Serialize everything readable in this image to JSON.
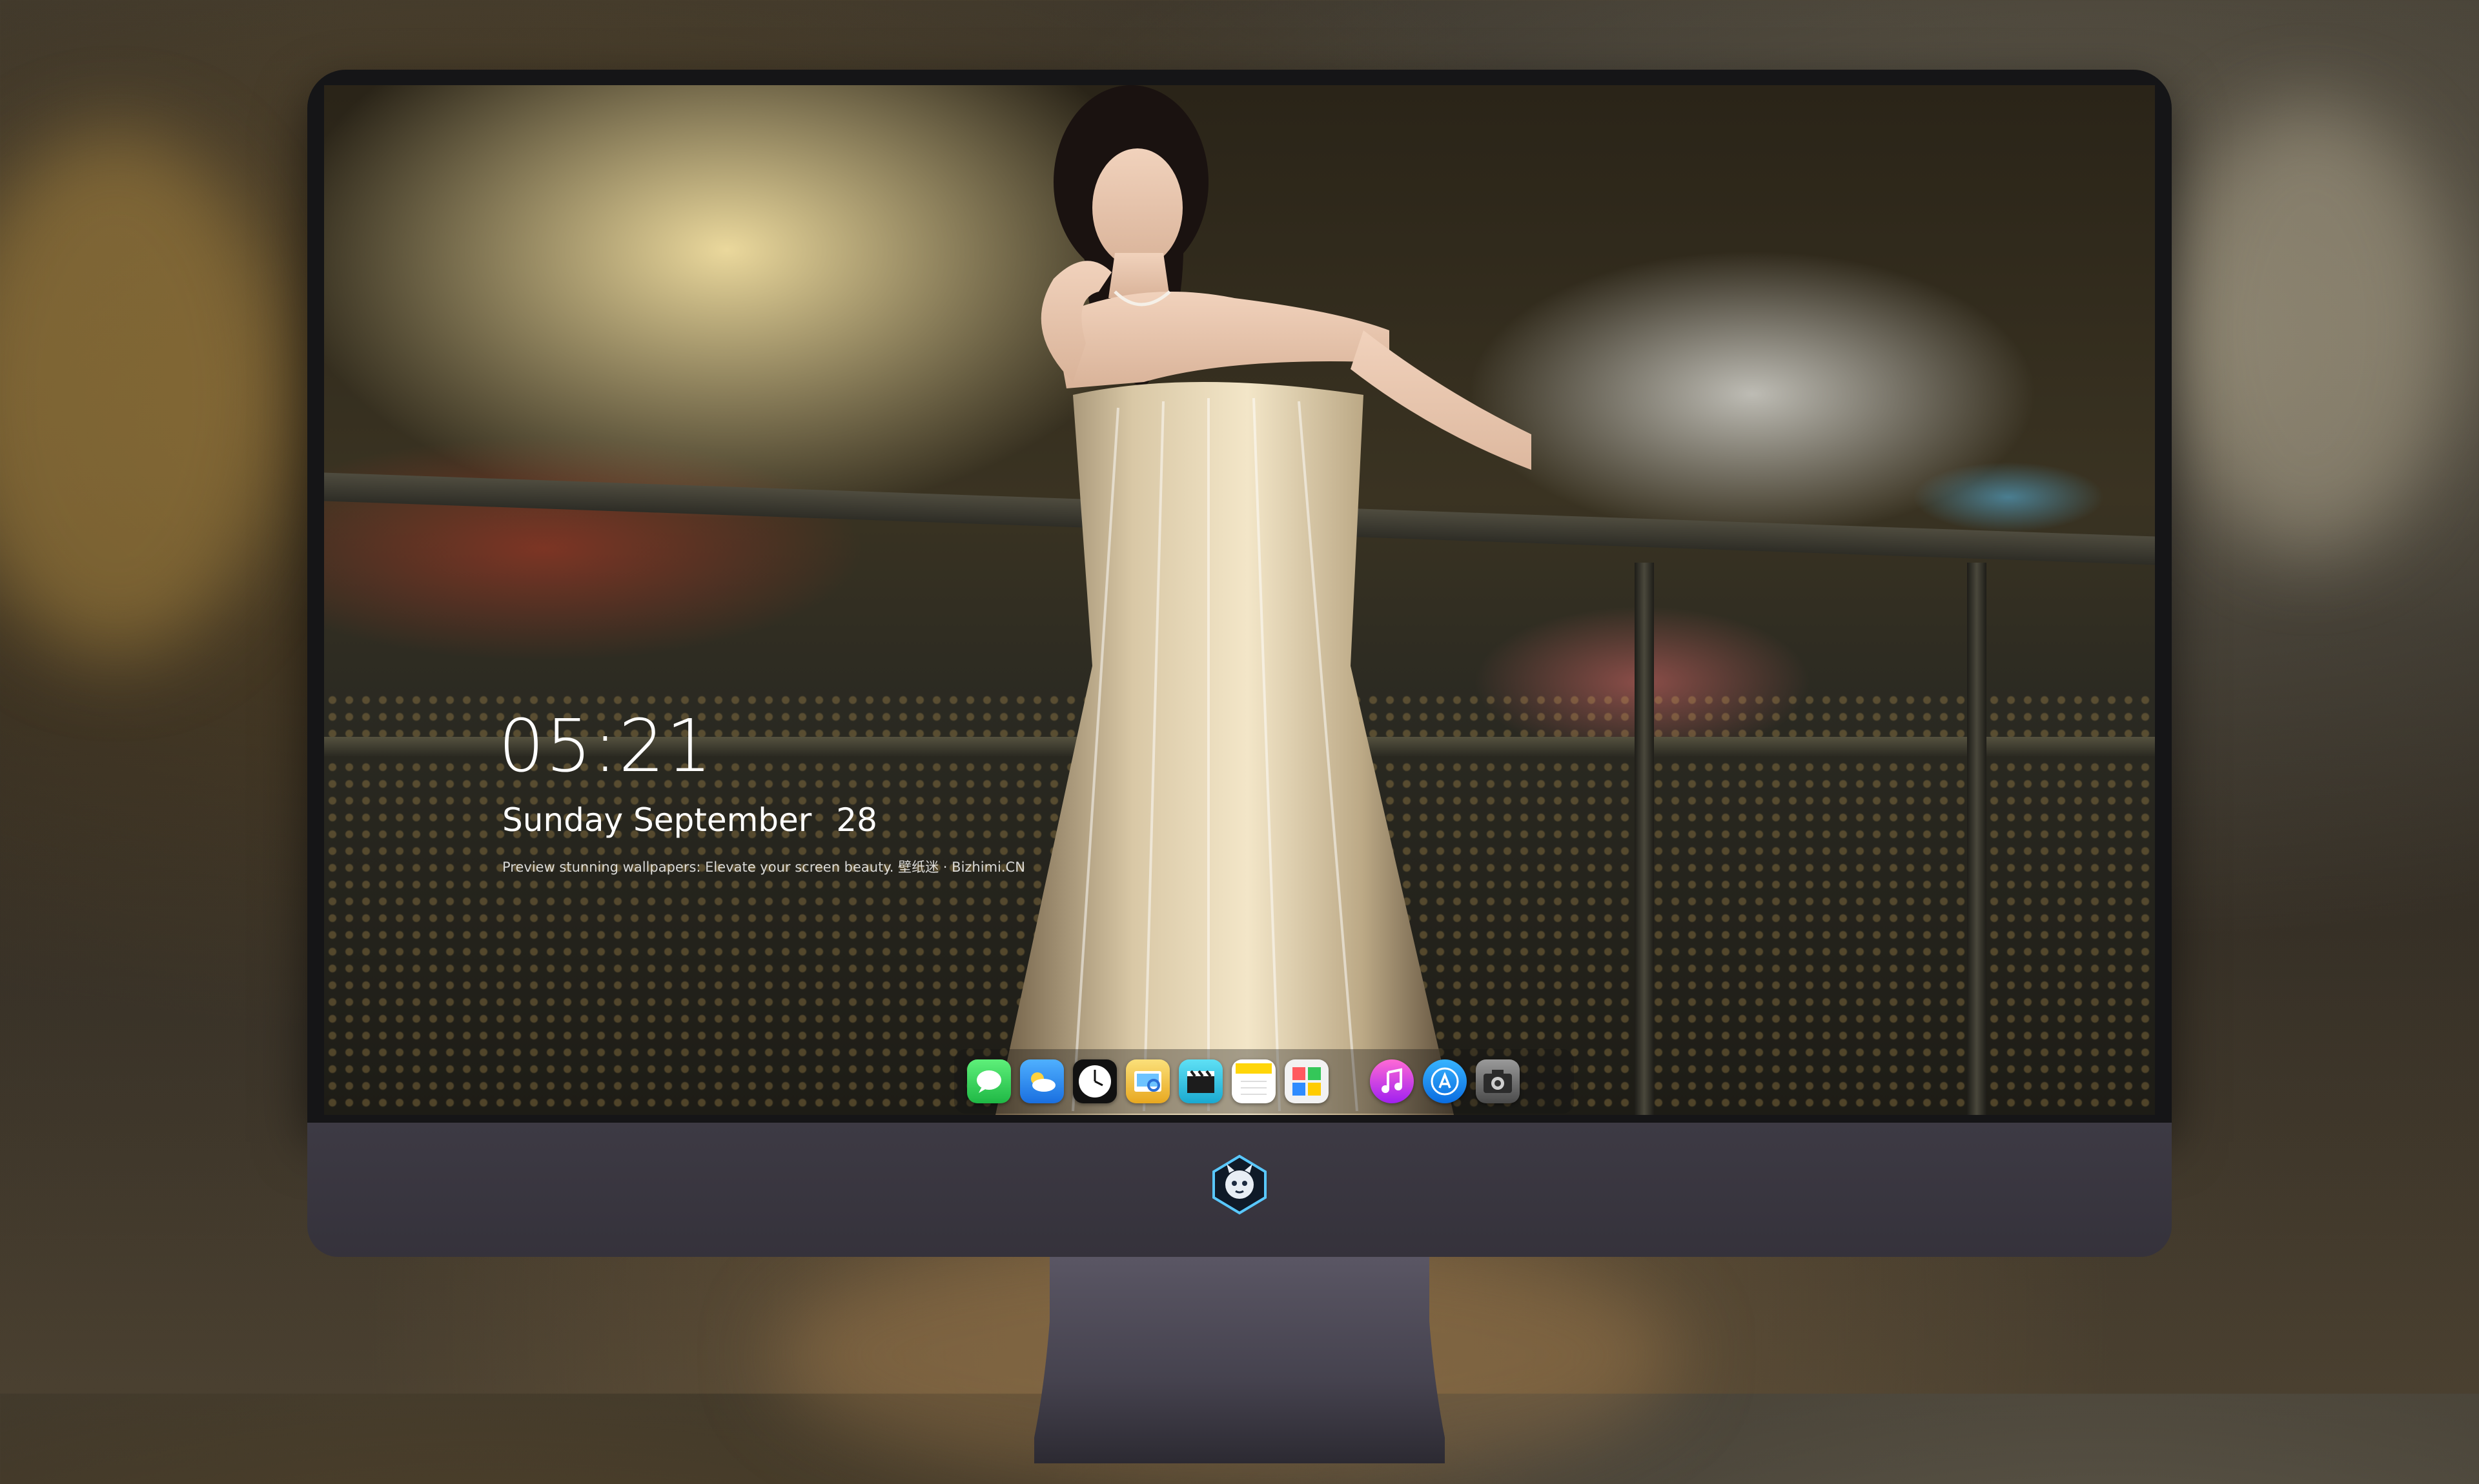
{
  "lock_screen": {
    "time": "05:21",
    "weekday": "Sunday",
    "month": "September",
    "day": "28",
    "tagline": "Preview stunning wallpapers: Elevate your screen beauty. 壁纸迷 · Bizhimi.CN"
  },
  "dock": {
    "apps": [
      {
        "icon": "messages-icon",
        "color": "#34c759"
      },
      {
        "icon": "weather-icon",
        "color": "#2f8cff"
      },
      {
        "icon": "clock-icon",
        "color": "#111111"
      },
      {
        "icon": "preview-icon",
        "color": "#f4c542"
      },
      {
        "icon": "clips-icon",
        "color": "#3cc8e6"
      },
      {
        "icon": "notes-icon",
        "color": "#ffd60a"
      },
      {
        "icon": "photo-booth-icon",
        "color": "#ffffff"
      },
      {
        "icon": "music-icon",
        "color": "#c040ff"
      },
      {
        "icon": "app-store-icon",
        "color": "#1a8cff"
      },
      {
        "icon": "camera-icon",
        "color": "#666666"
      }
    ]
  },
  "monitor": {
    "chin_logo": "mascot-logo-icon",
    "chin_color": "#3d3a44"
  }
}
